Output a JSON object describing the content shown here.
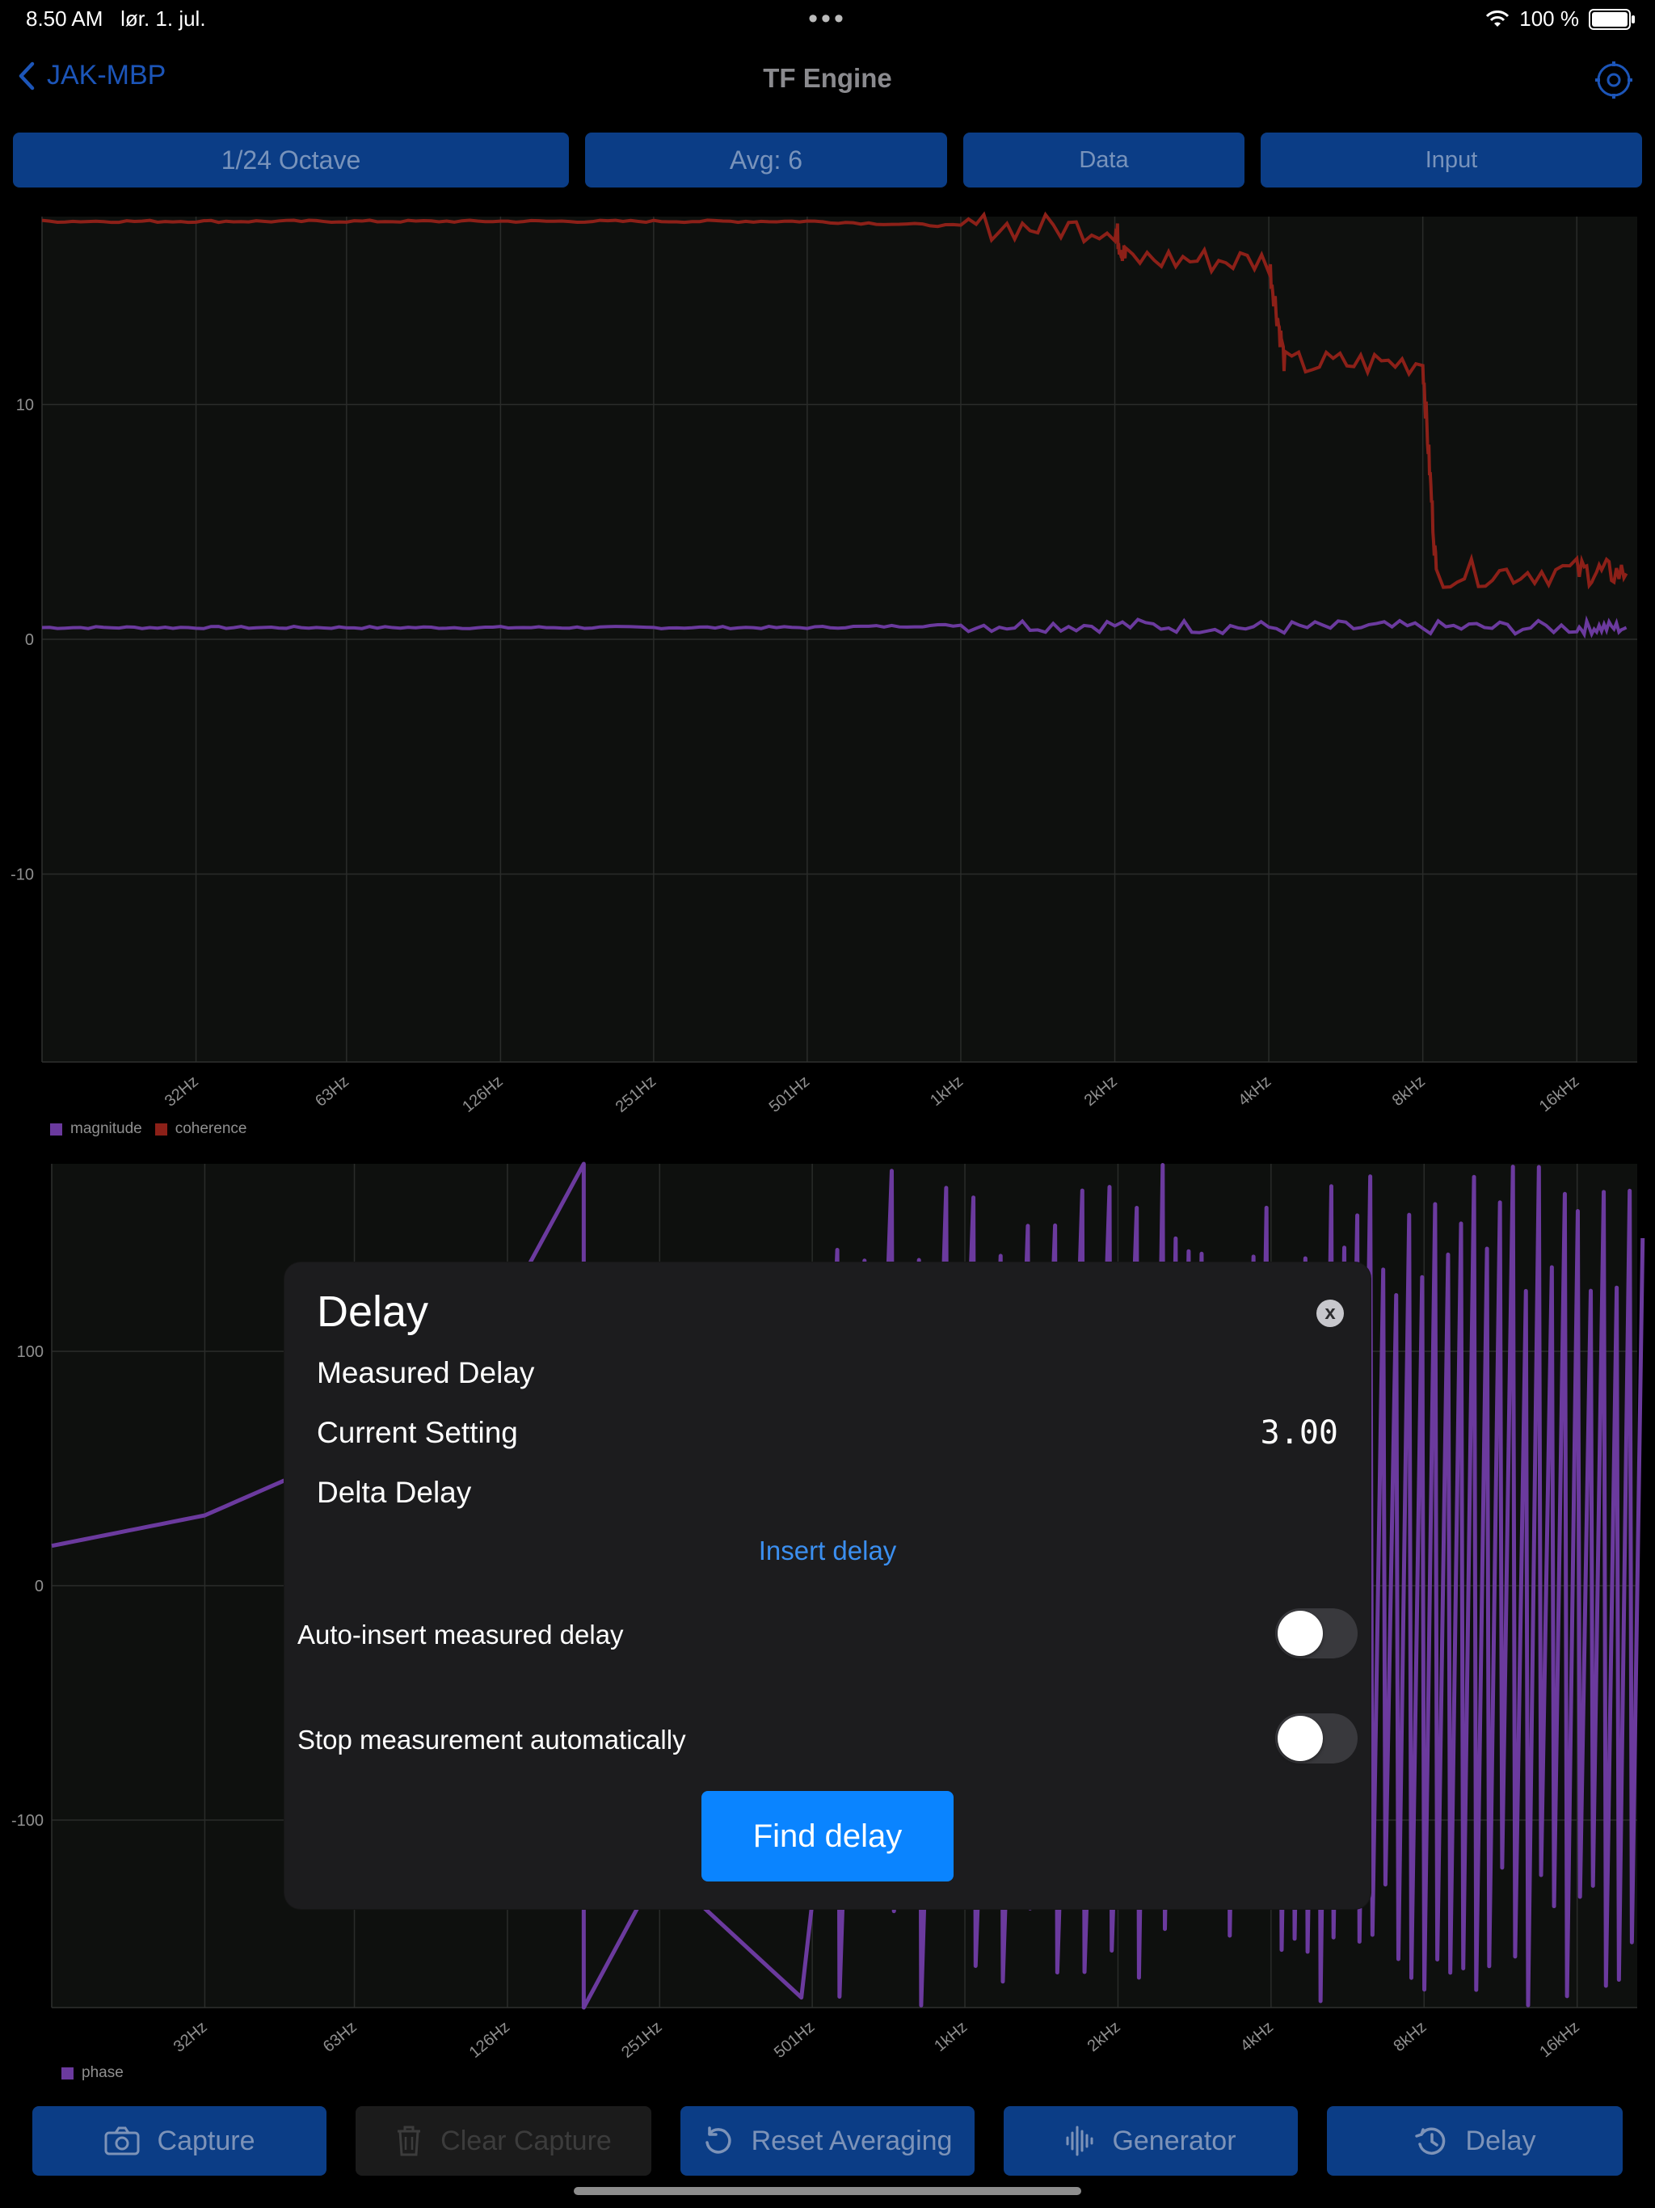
{
  "status_bar": {
    "time": "8.50 AM",
    "date": "lør. 1. jul.",
    "dots": "•••",
    "battery": "100 %"
  },
  "nav": {
    "back_label": "JAK-MBP",
    "title": "TF Engine"
  },
  "segments": [
    {
      "label": "1/24 Octave"
    },
    {
      "label": "Avg: 6"
    },
    {
      "label": "Data"
    },
    {
      "label": "Input"
    }
  ],
  "colors": {
    "accent": "#0a84ff",
    "button_bg": "#0b3d86",
    "magnitude": "#6b3a9e",
    "coherence": "#8c2018",
    "phase": "#6b3a9e"
  },
  "chart_data": [
    {
      "type": "line",
      "x_tick_labels": [
        "32Hz",
        "63Hz",
        "126Hz",
        "251Hz",
        "501Hz",
        "1kHz",
        "2kHz",
        "4kHz",
        "8kHz",
        "16kHz"
      ],
      "y_tick_labels": [
        "10",
        "0",
        "-10"
      ],
      "ylim": [
        -18,
        18
      ],
      "grid": true,
      "legend_position": "bottom-left",
      "series": [
        {
          "name": "magnitude",
          "color": "#6b3a9e",
          "points": [
            [
              16,
              0.5
            ],
            [
              32,
              0.5
            ],
            [
              63,
              0.5
            ],
            [
              126,
              0.5
            ],
            [
              251,
              0.5
            ],
            [
              501,
              0.5
            ],
            [
              1000,
              0.6
            ],
            [
              2000,
              0.6
            ],
            [
              4000,
              0.5
            ],
            [
              8000,
              0.5
            ],
            [
              16000,
              0.5
            ],
            [
              20000,
              0.5
            ]
          ]
        },
        {
          "name": "coherence",
          "color": "#8c2018",
          "points": [
            [
              16,
              17.8
            ],
            [
              32,
              17.8
            ],
            [
              63,
              17.8
            ],
            [
              126,
              17.8
            ],
            [
              251,
              17.8
            ],
            [
              501,
              17.8
            ],
            [
              1000,
              17.6
            ],
            [
              2000,
              17.5
            ],
            [
              2100,
              16.2
            ],
            [
              4000,
              16.1
            ],
            [
              4300,
              11.7
            ],
            [
              8000,
              11.8
            ],
            [
              8500,
              2.8
            ],
            [
              16000,
              2.9
            ],
            [
              20000,
              2.8
            ]
          ]
        }
      ]
    },
    {
      "type": "line",
      "x_tick_labels": [
        "32Hz",
        "63Hz",
        "126Hz",
        "251Hz",
        "501Hz",
        "1kHz",
        "2kHz",
        "4kHz",
        "8kHz",
        "16kHz"
      ],
      "y_tick_labels": [
        "100",
        "0",
        "-100"
      ],
      "ylim": [
        -180,
        180
      ],
      "grid": true,
      "legend_position": "bottom-left",
      "series": [
        {
          "name": "phase",
          "color": "#6b3a9e",
          "points": [
            [
              16,
              17
            ],
            [
              32,
              30
            ],
            [
              63,
              58
            ],
            [
              126,
              120
            ],
            [
              178,
              180
            ],
            [
              178,
              -180
            ],
            [
              251,
              -120
            ],
            [
              501,
              -180
            ]
          ]
        }
      ]
    }
  ],
  "dialog": {
    "title": "Delay",
    "close": "x",
    "measured_delay_label": "Measured Delay",
    "current_setting_label": "Current Setting",
    "current_setting_value": "3.00",
    "delta_delay_label": "Delta Delay",
    "insert_delay_link": "Insert delay",
    "auto_insert_label": "Auto-insert measured delay",
    "auto_insert_on": false,
    "stop_auto_label": "Stop measurement automatically",
    "stop_auto_on": false,
    "find_delay_button": "Find delay"
  },
  "toolbar": [
    {
      "label": "Capture",
      "icon": "camera-icon",
      "enabled": true
    },
    {
      "label": "Clear Capture",
      "icon": "trash-icon",
      "enabled": false
    },
    {
      "label": "Reset Averaging",
      "icon": "reset-icon",
      "enabled": true
    },
    {
      "label": "Generator",
      "icon": "waveform-icon",
      "enabled": true
    },
    {
      "label": "Delay",
      "icon": "clock-history-icon",
      "enabled": true
    }
  ]
}
